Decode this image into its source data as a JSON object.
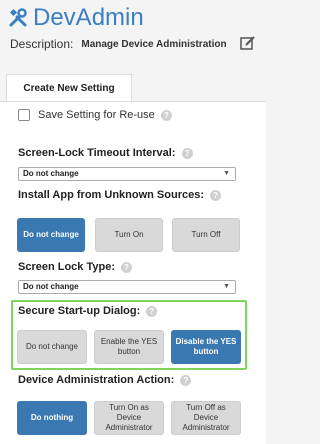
{
  "app": {
    "title": "DevAdmin",
    "logo_icon": "tools-icon"
  },
  "description": {
    "label": "Description:",
    "value": "Manage Device Administration",
    "edit_icon": "edit-icon"
  },
  "tabs": [
    {
      "label": "Create New Setting",
      "active": true
    }
  ],
  "save_setting": {
    "label": "Save Setting for Re-use",
    "checked": false
  },
  "screen_lock_timeout": {
    "label": "Screen-Lock Timeout Interval:",
    "value": "Do not change"
  },
  "unknown_sources": {
    "label": "Install App from Unknown Sources:",
    "options": [
      "Do not change",
      "Turn On",
      "Turn Off"
    ],
    "selected": "Do not change"
  },
  "screen_lock_type": {
    "label": "Screen Lock Type:",
    "value": "Do not change"
  },
  "secure_startup": {
    "label": "Secure Start-up Dialog:",
    "options": [
      "Do not change",
      "Enable the YES button",
      "Disable the YES button"
    ],
    "selected": "Disable the YES button"
  },
  "device_admin_action": {
    "label": "Device Administration Action:",
    "options": [
      "Do nothing",
      "Turn On as Device Administrator",
      "Turn Off as Device Administrator"
    ],
    "selected": "Do nothing"
  },
  "colors": {
    "accent": "#3a7fc1",
    "selected_button": "#3978b1",
    "highlight": "#7dd65e"
  },
  "help_glyph": "?"
}
